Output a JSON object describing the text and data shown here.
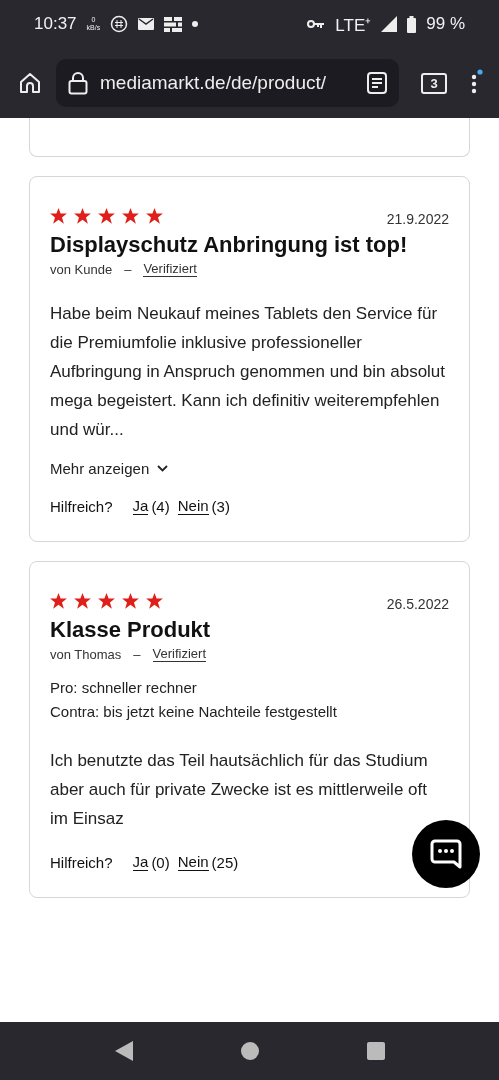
{
  "status_bar": {
    "time": "10:37",
    "data_rate": "0",
    "data_unit": "kB/s",
    "network": "LTE⁺",
    "battery": "99 %"
  },
  "browser": {
    "url": "mediamarkt.de/de/product/",
    "tab_count": "3"
  },
  "reviews": [
    {
      "stars": 5,
      "date": "21.9.2022",
      "title": "Displayschutz Anbringung ist top!",
      "author": "von Kunde",
      "separator": "–",
      "verified": "Verifiziert",
      "body": "Habe beim Neukauf meines Tablets den Service für die Premiumfolie inklusive professioneller Aufbringung in Anspruch genommen und bin absolut mega begeistert. Kann ich definitiv weiterempfehlen und wür...",
      "more": "Mehr anzeigen",
      "helpful": "Hilfreich?",
      "yes": "Ja",
      "yes_count": "(4)",
      "no": "Nein",
      "no_count": "(3)"
    },
    {
      "stars": 5,
      "date": "26.5.2022",
      "title": "Klasse Produkt",
      "author": "von Thomas",
      "separator": "–",
      "verified": "Verifiziert",
      "pros_cons": [
        "Pro: schneller rechner",
        "Contra: bis jetzt keine Nachteile festgestellt"
      ],
      "body": "Ich benutzte das Teil hautsächlich für das Studium aber auch für private Zwecke ist es mittlerweile oft im Einsaz",
      "helpful": "Hilfreich?",
      "yes": "Ja",
      "yes_count": "(0)",
      "no": "Nein",
      "no_count": "(25)"
    }
  ]
}
